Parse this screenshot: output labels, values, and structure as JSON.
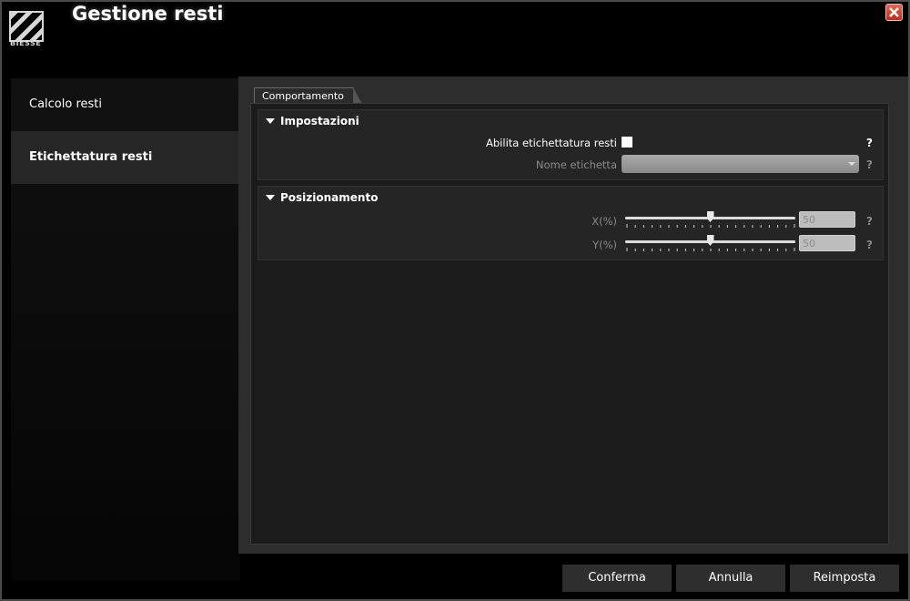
{
  "window": {
    "title": "Gestione resti",
    "logo_text": "BIESSE",
    "close_icon": "close-icon"
  },
  "sidebar": {
    "items": [
      {
        "label": "Calcolo resti",
        "active": false
      },
      {
        "label": "Etichettatura resti",
        "active": true
      }
    ]
  },
  "tabs": [
    {
      "label": "Comportamento",
      "active": true
    }
  ],
  "impostazioni": {
    "header": "Impostazioni",
    "enable_label": "Abilita etichettatura resti",
    "enable_checked": false,
    "name_label": "Nome etichetta",
    "name_value": "",
    "help": "?"
  },
  "posizionamento": {
    "header": "Posizionamento",
    "x_label": "X(%)",
    "x_value": "50",
    "y_label": "Y(%)",
    "y_value": "50",
    "help": "?"
  },
  "footer": {
    "confirm": "Conferma",
    "cancel": "Annulla",
    "reset": "Reimposta"
  },
  "colors": {
    "background": "#000000",
    "panel": "#2d2d2d",
    "close": "#c8412b"
  }
}
